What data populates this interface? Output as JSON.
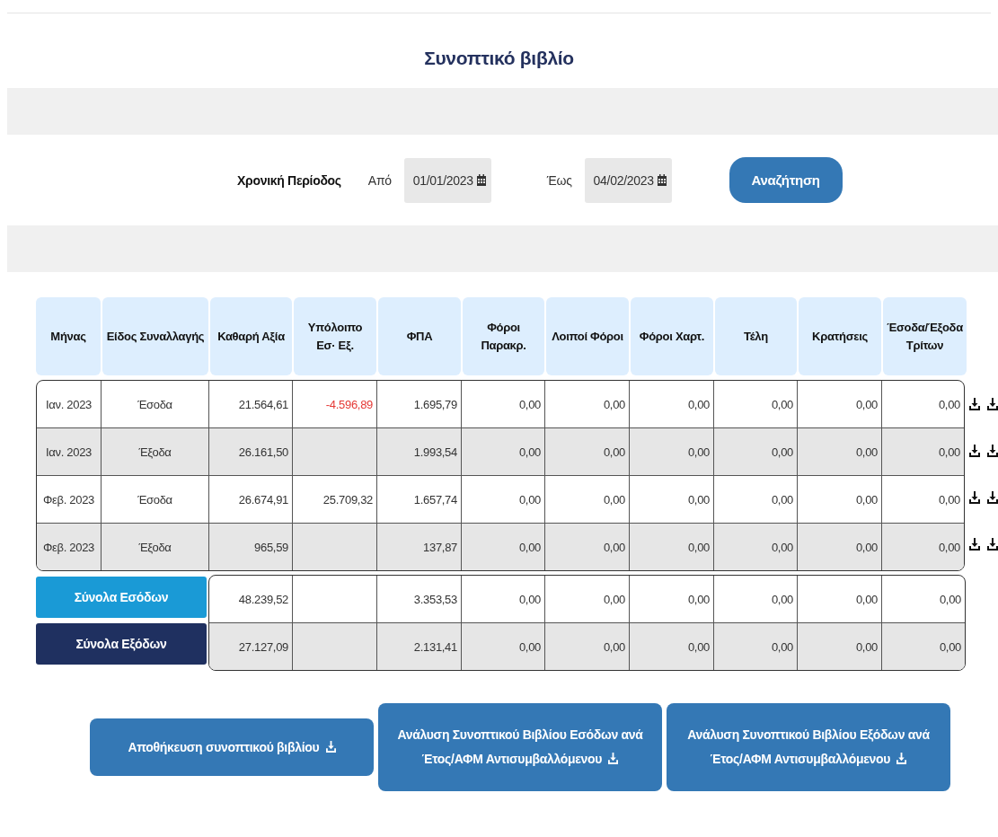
{
  "title": "Συνοπτικό βιβλίο",
  "filter": {
    "label": "Χρονική Περίοδος",
    "from_label": "Από",
    "from_value": "01/01/2023",
    "to_label": "Έως",
    "to_value": "04/02/2023",
    "search_button": "Αναζήτηση"
  },
  "table": {
    "columns": [
      "Μήνας",
      "Είδος Συναλλαγής",
      "Καθαρή Αξία",
      "Υπόλοιπο Εσ· Εξ.",
      "ΦΠΑ",
      "Φόροι Παρακρ.",
      "Λοιποί Φόροι",
      "Φόροι Χαρτ.",
      "Τέλη",
      "Κρατήσεις",
      "Έσοδα/Έξοδα Τρίτων"
    ],
    "rows": [
      {
        "month": "Ιαν. 2023",
        "type": "Έσοδα",
        "net": "21.564,61",
        "balance": {
          "text": "-4.596,89",
          "negative": true
        },
        "vat": "1.695,79",
        "others": [
          "0,00",
          "0,00",
          "0,00",
          "0,00",
          "0,00",
          "0,00"
        ]
      },
      {
        "month": "Ιαν. 2023",
        "type": "Έξοδα",
        "net": "26.161,50",
        "vat": "1.993,54",
        "others": [
          "0,00",
          "0,00",
          "0,00",
          "0,00",
          "0,00",
          "0,00"
        ]
      },
      {
        "month": "Φεβ. 2023",
        "type": "Έσοδα",
        "net": "26.674,91",
        "balance": {
          "text": "25.709,32",
          "negative": false
        },
        "vat": "1.657,74",
        "others": [
          "0,00",
          "0,00",
          "0,00",
          "0,00",
          "0,00",
          "0,00"
        ]
      },
      {
        "month": "Φεβ. 2023",
        "type": "Έξοδα",
        "net": "965,59",
        "vat": "137,87",
        "others": [
          "0,00",
          "0,00",
          "0,00",
          "0,00",
          "0,00",
          "0,00"
        ]
      }
    ],
    "totals": [
      {
        "kind": "income",
        "label": "Σύνολα Εσόδων",
        "net": "48.239,52",
        "vat": "3.353,53",
        "others": [
          "0,00",
          "0,00",
          "0,00",
          "0,00",
          "0,00",
          "0,00"
        ]
      },
      {
        "kind": "expense",
        "label": "Σύνολα Εξόδων",
        "net": "27.127,09",
        "vat": "2.131,41",
        "others": [
          "0,00",
          "0,00",
          "0,00",
          "0,00",
          "0,00",
          "0,00"
        ]
      }
    ]
  },
  "actions": [
    "Αποθήκευση συνοπτικού βιβλίου",
    "Ανάλυση Συνοπτικού Βιβλίου Εσόδων ανά Έτος/ΑΦΜ Αντισυμβαλλόμενου",
    "Ανάλυση Συνοπτικού Βιβλίου Εξόδων ανά Έτος/ΑΦΜ Αντισυμβαλλόμενου"
  ]
}
